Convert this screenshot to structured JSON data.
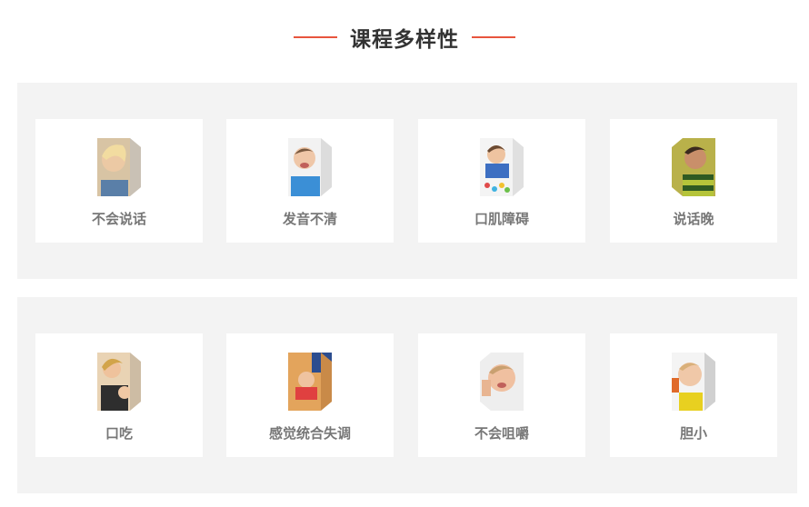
{
  "section": {
    "title": "课程多样性"
  },
  "rows": [
    {
      "cards": [
        {
          "label": "不会说话",
          "image": "child-listening-image"
        },
        {
          "label": "发音不清",
          "image": "child-crying-image"
        },
        {
          "label": "口肌障碍",
          "image": "child-playing-image"
        },
        {
          "label": "说话晚",
          "image": "child-eating-image"
        }
      ]
    },
    {
      "cards": [
        {
          "label": "口吃",
          "image": "mother-child-image"
        },
        {
          "label": "感觉统合失调",
          "image": "child-crawling-image"
        },
        {
          "label": "不会咀嚼",
          "image": "child-chewing-image"
        },
        {
          "label": "胆小",
          "image": "child-shy-image"
        }
      ]
    }
  ],
  "colors": {
    "accent": "#e8553e",
    "panel_background": "#f3f3f3",
    "card_background": "#ffffff",
    "title_text": "#333333",
    "label_text": "#777777"
  }
}
